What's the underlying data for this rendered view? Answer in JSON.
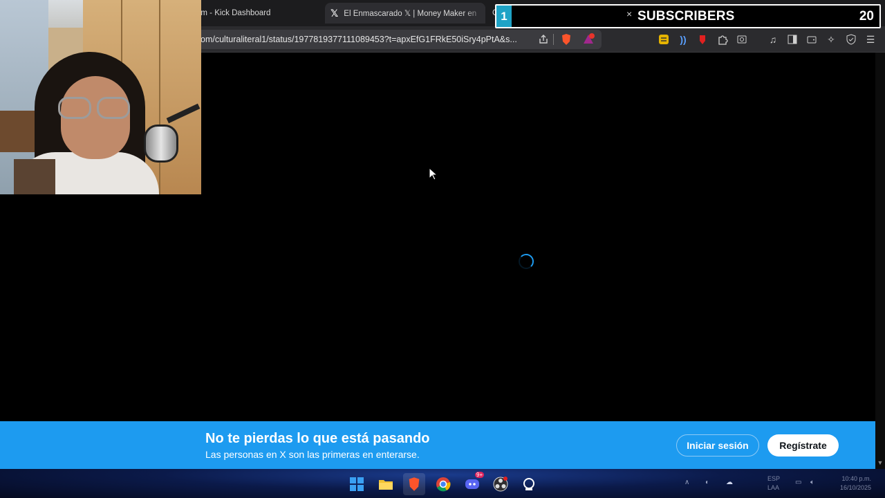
{
  "browser": {
    "tabs": [
      {
        "label": "am - Kick Dashboard"
      },
      {
        "label": "El Enmascarado 𝕏 | Money Maker en",
        "icon": "x-logo-icon"
      },
      {
        "label": "G"
      }
    ],
    "url": "om/culturaliteral1/status/1977819377111089453?t=apxEfG1FRkE50iSry4pPtA&s..."
  },
  "overlay": {
    "subscriber_count": "1",
    "close_glyph": "×",
    "subscribers_label": "SUBSCRIBERS",
    "goal": "20",
    "accent_color": "#1fa3c6"
  },
  "banner": {
    "title": "No te pierdas lo que está pasando",
    "subtitle": "Las personas en X son las primeras en enterarse.",
    "login_label": "Iniciar sesión",
    "signup_label": "Regístrate",
    "background_color": "#1d9bf0"
  },
  "taskbar": {
    "apps": [
      "windows-start-icon",
      "file-explorer-icon",
      "brave-browser-icon",
      "chrome-icon",
      "discord-icon",
      "obs-icon",
      "app-icon"
    ],
    "discord_badge": "9+",
    "tray_language": [
      "ESP",
      "LAA"
    ],
    "clock": [
      "10:40 p.m.",
      "16/10/2025"
    ]
  }
}
